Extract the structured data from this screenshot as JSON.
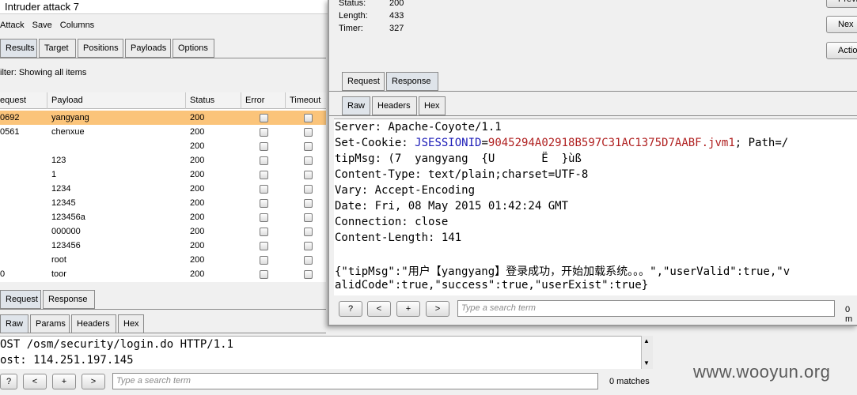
{
  "back_window": {
    "title": "Intruder attack 7",
    "menu": [
      "Attack",
      "Save",
      "Columns"
    ],
    "tabs": [
      "Results",
      "Target",
      "Positions",
      "Payloads",
      "Options"
    ],
    "filter": "ilter: Showing all items",
    "columns": [
      "equest",
      "Payload",
      "Status",
      "Error",
      "Timeout"
    ],
    "rows": [
      {
        "request": "0692",
        "payload": "yangyang",
        "status": "200"
      },
      {
        "request": "0561",
        "payload": "chenxue",
        "status": "200"
      },
      {
        "request": "",
        "payload": "",
        "status": "200"
      },
      {
        "request": "",
        "payload": "123",
        "status": "200"
      },
      {
        "request": "",
        "payload": "1",
        "status": "200"
      },
      {
        "request": "",
        "payload": "1234",
        "status": "200"
      },
      {
        "request": "",
        "payload": "12345",
        "status": "200"
      },
      {
        "request": "",
        "payload": "123456a",
        "status": "200"
      },
      {
        "request": "",
        "payload": "000000",
        "status": "200"
      },
      {
        "request": "",
        "payload": "123456",
        "status": "200"
      },
      {
        "request": "",
        "payload": "root",
        "status": "200"
      },
      {
        "request": "0",
        "payload": "toor",
        "status": "200"
      }
    ],
    "req_resp_tabs": [
      "Request",
      "Response"
    ],
    "view_tabs": [
      "Raw",
      "Params",
      "Headers",
      "Hex"
    ],
    "request_lines": [
      "OST /osm/security/login.do HTTP/1.1",
      "ost: 114.251.197.145"
    ],
    "buttons": [
      "?",
      "<",
      "+",
      ">"
    ],
    "search_placeholder": "Type a search term",
    "matches": "0 matches"
  },
  "front_window": {
    "stats": [
      {
        "label": "Status:",
        "value": "200"
      },
      {
        "label": "Length:",
        "value": "433"
      },
      {
        "label": "Timer:",
        "value": "327"
      }
    ],
    "side_buttons": [
      "Previ",
      "Nex",
      "Actio"
    ],
    "req_resp_tabs": [
      "Request",
      "Response"
    ],
    "view_tabs": [
      "Raw",
      "Headers",
      "Hex"
    ],
    "response": {
      "server": "Server: Apache-Coyote/1.1",
      "cookie_prefix": "Set-Cookie: ",
      "cookie_name": "JSESSIONID",
      "cookie_eq": "=",
      "cookie_value": "9045294A02918B597C31AC1375D7AABF.jvm1",
      "cookie_suffix": "; Path=/",
      "tipmsg": "tipMsg: (7  yangyang  {U       Ë  }ùß",
      "content_type": "Content-Type: text/plain;charset=UTF-8",
      "vary": "Vary: Accept-Encoding",
      "date": "Date: Fri, 08 May 2015 01:42:24 GMT",
      "connection": "Connection: close",
      "content_length": "Content-Length: 141",
      "body1": "{\"tipMsg\":\"用户【yangyang】登录成功，开始加载系统。。。\",\"userValid\":true,\"v",
      "body2": "alidCode\":true,\"success\":true,\"userExist\":true}"
    },
    "buttons": [
      "?",
      "<",
      "+",
      ">"
    ],
    "search_placeholder": "Type a search term",
    "matches": "0 m"
  },
  "watermark": "www.wooyun.org"
}
